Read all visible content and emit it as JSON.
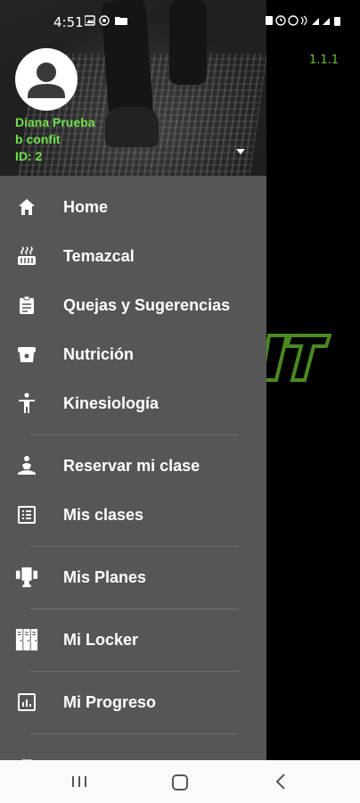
{
  "status_bar": {
    "time": "4:51"
  },
  "app": {
    "version": "1.1.1",
    "brand_color": "#6fe04a"
  },
  "drawer": {
    "user": {
      "name": "Diana Prueba",
      "line2": "b confit",
      "line3": "ID: 2"
    },
    "menu": [
      {
        "label": "Home",
        "icon": "home-icon"
      },
      {
        "label": "Temazcal",
        "icon": "temazcal-icon"
      },
      {
        "label": "Quejas y Sugerencias",
        "icon": "clipboard-icon"
      },
      {
        "label": "Nutrición",
        "icon": "nutrition-icon"
      },
      {
        "label": "Kinesiología",
        "icon": "person-standing-icon"
      },
      {
        "label": "Reservar mi clase",
        "icon": "meditation-icon"
      },
      {
        "label": "Mis clases",
        "icon": "list-icon"
      },
      {
        "label": "Mis Planes",
        "icon": "plans-icon"
      },
      {
        "label": "Mi Locker",
        "icon": "locker-icon"
      },
      {
        "label": "Mi Progreso",
        "icon": "chart-icon"
      }
    ]
  },
  "colors": {
    "drawer_bg": "#565656",
    "version_text": "#6fbf3a",
    "user_text": "#6fe04a"
  }
}
